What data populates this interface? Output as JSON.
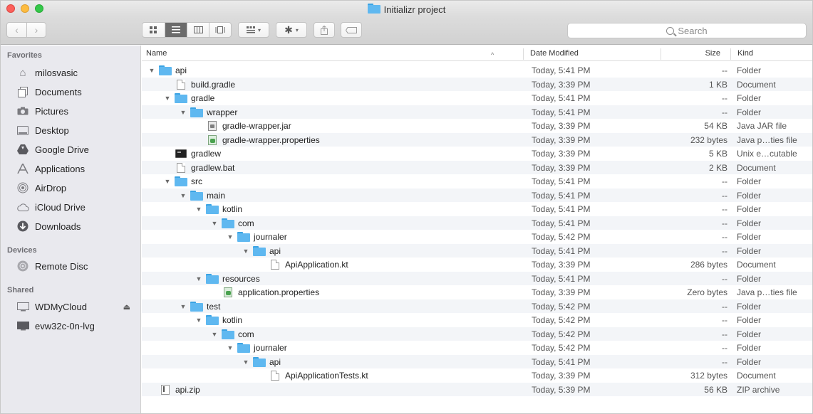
{
  "window": {
    "title": "Initializr project"
  },
  "toolbar": {
    "back_glyph": "‹",
    "forward_glyph": "›",
    "search_placeholder": "Search",
    "view_modes": [
      "icon-view-icon",
      "list-view-icon",
      "column-view-icon",
      "gallery-view-icon"
    ],
    "active_view": "list"
  },
  "sidebar": {
    "favorites_heading": "Favorites",
    "favorites": [
      {
        "label": "milosvasic",
        "icon": "home-icon"
      },
      {
        "label": "Documents",
        "icon": "documents-icon"
      },
      {
        "label": "Pictures",
        "icon": "camera-icon"
      },
      {
        "label": "Desktop",
        "icon": "desktop-icon"
      },
      {
        "label": "Google Drive",
        "icon": "google-drive-icon"
      },
      {
        "label": "Applications",
        "icon": "applications-icon"
      },
      {
        "label": "AirDrop",
        "icon": "airdrop-icon"
      },
      {
        "label": "iCloud Drive",
        "icon": "cloud-icon"
      },
      {
        "label": "Downloads",
        "icon": "download-icon"
      }
    ],
    "devices_heading": "Devices",
    "devices": [
      {
        "label": "Remote Disc",
        "icon": "disc-icon"
      }
    ],
    "shared_heading": "Shared",
    "shared": [
      {
        "label": "WDMyCloud",
        "icon": "display-icon",
        "eject": true
      },
      {
        "label": "evw32c-0n-lvg",
        "icon": "computer-icon"
      }
    ]
  },
  "columns": {
    "name": "Name",
    "date": "Date Modified",
    "size": "Size",
    "kind": "Kind"
  },
  "files": [
    {
      "name": "api",
      "depth": 0,
      "type": "folder",
      "expanded": true,
      "date": "Today, 5:41 PM",
      "size": "--",
      "kind": "Folder"
    },
    {
      "name": "build.gradle",
      "depth": 1,
      "type": "doc",
      "date": "Today, 3:39 PM",
      "size": "1 KB",
      "kind": "Document"
    },
    {
      "name": "gradle",
      "depth": 1,
      "type": "folder",
      "expanded": true,
      "date": "Today, 5:41 PM",
      "size": "--",
      "kind": "Folder"
    },
    {
      "name": "wrapper",
      "depth": 2,
      "type": "folder",
      "expanded": true,
      "date": "Today, 5:41 PM",
      "size": "--",
      "kind": "Folder"
    },
    {
      "name": "gradle-wrapper.jar",
      "depth": 3,
      "type": "jar",
      "date": "Today, 3:39 PM",
      "size": "54 KB",
      "kind": "Java JAR file"
    },
    {
      "name": "gradle-wrapper.properties",
      "depth": 3,
      "type": "prop",
      "date": "Today, 3:39 PM",
      "size": "232 bytes",
      "kind": "Java p…ties file"
    },
    {
      "name": "gradlew",
      "depth": 1,
      "type": "exec",
      "date": "Today, 3:39 PM",
      "size": "5 KB",
      "kind": "Unix e…cutable"
    },
    {
      "name": "gradlew.bat",
      "depth": 1,
      "type": "doc",
      "date": "Today, 3:39 PM",
      "size": "2 KB",
      "kind": "Document"
    },
    {
      "name": "src",
      "depth": 1,
      "type": "folder",
      "expanded": true,
      "date": "Today, 5:41 PM",
      "size": "--",
      "kind": "Folder"
    },
    {
      "name": "main",
      "depth": 2,
      "type": "folder",
      "expanded": true,
      "date": "Today, 5:41 PM",
      "size": "--",
      "kind": "Folder"
    },
    {
      "name": "kotlin",
      "depth": 3,
      "type": "folder",
      "expanded": true,
      "date": "Today, 5:41 PM",
      "size": "--",
      "kind": "Folder"
    },
    {
      "name": "com",
      "depth": 4,
      "type": "folder",
      "expanded": true,
      "date": "Today, 5:41 PM",
      "size": "--",
      "kind": "Folder"
    },
    {
      "name": "journaler",
      "depth": 5,
      "type": "folder",
      "expanded": true,
      "date": "Today, 5:42 PM",
      "size": "--",
      "kind": "Folder"
    },
    {
      "name": "api",
      "depth": 6,
      "type": "folder",
      "expanded": true,
      "date": "Today, 5:41 PM",
      "size": "--",
      "kind": "Folder"
    },
    {
      "name": "ApiApplication.kt",
      "depth": 7,
      "type": "doc",
      "date": "Today, 3:39 PM",
      "size": "286 bytes",
      "kind": "Document"
    },
    {
      "name": "resources",
      "depth": 3,
      "type": "folder",
      "expanded": true,
      "date": "Today, 5:41 PM",
      "size": "--",
      "kind": "Folder"
    },
    {
      "name": "application.properties",
      "depth": 4,
      "type": "prop",
      "date": "Today, 3:39 PM",
      "size": "Zero bytes",
      "kind": "Java p…ties file"
    },
    {
      "name": "test",
      "depth": 2,
      "type": "folder",
      "expanded": true,
      "date": "Today, 5:42 PM",
      "size": "--",
      "kind": "Folder"
    },
    {
      "name": "kotlin",
      "depth": 3,
      "type": "folder",
      "expanded": true,
      "date": "Today, 5:42 PM",
      "size": "--",
      "kind": "Folder"
    },
    {
      "name": "com",
      "depth": 4,
      "type": "folder",
      "expanded": true,
      "date": "Today, 5:42 PM",
      "size": "--",
      "kind": "Folder"
    },
    {
      "name": "journaler",
      "depth": 5,
      "type": "folder",
      "expanded": true,
      "date": "Today, 5:42 PM",
      "size": "--",
      "kind": "Folder"
    },
    {
      "name": "api",
      "depth": 6,
      "type": "folder",
      "expanded": true,
      "date": "Today, 5:41 PM",
      "size": "--",
      "kind": "Folder"
    },
    {
      "name": "ApiApplicationTests.kt",
      "depth": 7,
      "type": "doc",
      "date": "Today, 3:39 PM",
      "size": "312 bytes",
      "kind": "Document"
    },
    {
      "name": "api.zip",
      "depth": 0,
      "type": "zip",
      "date": "Today, 5:39 PM",
      "size": "56 KB",
      "kind": "ZIP archive"
    }
  ]
}
